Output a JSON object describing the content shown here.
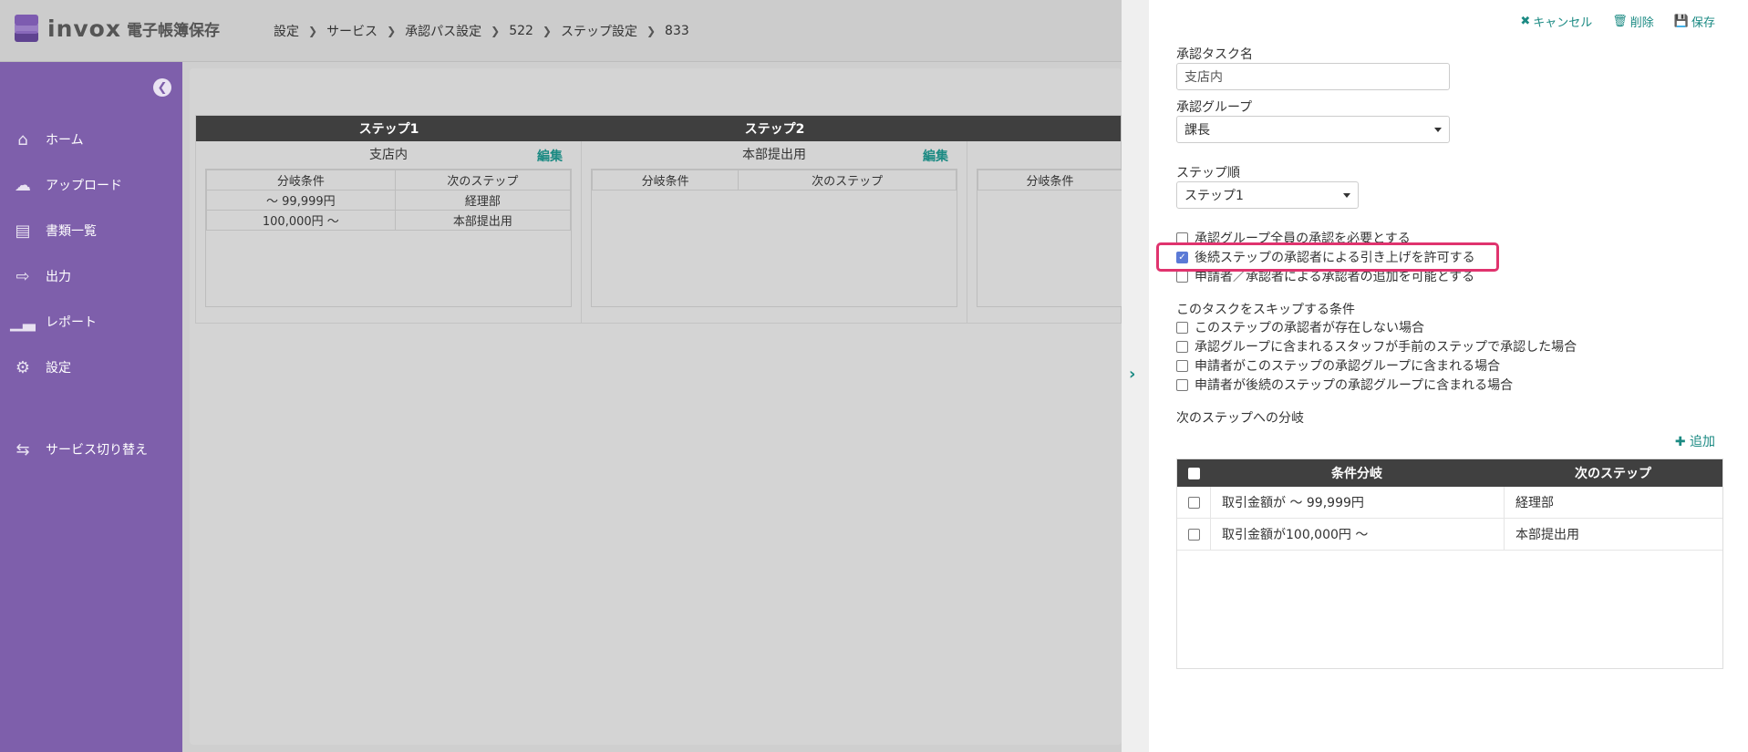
{
  "header": {
    "logo_text": "invox",
    "logo_sub": "電子帳簿保存",
    "breadcrumb": [
      "設定",
      "サービス",
      "承認パス設定",
      "522",
      "ステップ設定",
      "833"
    ]
  },
  "sidebar": {
    "items": [
      {
        "label": "ホーム",
        "icon": "home-icon"
      },
      {
        "label": "アップロード",
        "icon": "cloud-upload-icon"
      },
      {
        "label": "書類一覧",
        "icon": "document-icon"
      },
      {
        "label": "出力",
        "icon": "export-icon"
      },
      {
        "label": "レポート",
        "icon": "bar-chart-icon"
      },
      {
        "label": "設定",
        "icon": "gear-icon"
      }
    ],
    "switch_label": "サービス切り替え"
  },
  "board": {
    "step_headers": [
      "ステップ1",
      "ステップ2"
    ],
    "edit_label": "編集",
    "columns": [
      {
        "title": "支店内",
        "table_headers": [
          "分岐条件",
          "次のステップ"
        ],
        "rows": [
          [
            "〜 99,999円",
            "経理部"
          ],
          [
            "100,000円 〜",
            "本部提出用"
          ]
        ]
      },
      {
        "title": "本部提出用",
        "table_headers": [
          "分岐条件",
          "次のステップ"
        ],
        "rows": []
      },
      {
        "title": "",
        "table_headers": [
          "分岐条件"
        ],
        "rows": []
      }
    ]
  },
  "panel": {
    "actions": {
      "cancel": "キャンセル",
      "delete": "削除",
      "save": "保存"
    },
    "task_name_label": "承認タスク名",
    "task_name_value": "支店内",
    "group_label": "承認グループ",
    "group_value": "課長",
    "order_label": "ステップ順",
    "order_value": "ステップ1",
    "options": [
      {
        "label": "承認グループ全員の承認を必要とする",
        "checked": false
      },
      {
        "label": "後続ステップの承認者による引き上げを許可する",
        "checked": true
      },
      {
        "label": "申請者／承認者による承認者の追加を可能とする",
        "checked": false
      }
    ],
    "skip_label": "このタスクをスキップする条件",
    "skip_options": [
      {
        "label": "このステップの承認者が存在しない場合",
        "checked": false
      },
      {
        "label": "承認グループに含まれるスタッフが手前のステップで承認した場合",
        "checked": false
      },
      {
        "label": "申請者がこのステップの承認グループに含まれる場合",
        "checked": false
      },
      {
        "label": "申請者が後続のステップの承認グループに含まれる場合",
        "checked": false
      }
    ],
    "branch_label": "次のステップへの分岐",
    "add_label": "追加",
    "branch_table": {
      "headers": [
        "条件分岐",
        "次のステップ"
      ],
      "rows": [
        {
          "condition": "取引金額が 〜 99,999円",
          "next": "経理部"
        },
        {
          "condition": "取引金額が100,000円 〜",
          "next": "本部提出用"
        }
      ]
    }
  }
}
